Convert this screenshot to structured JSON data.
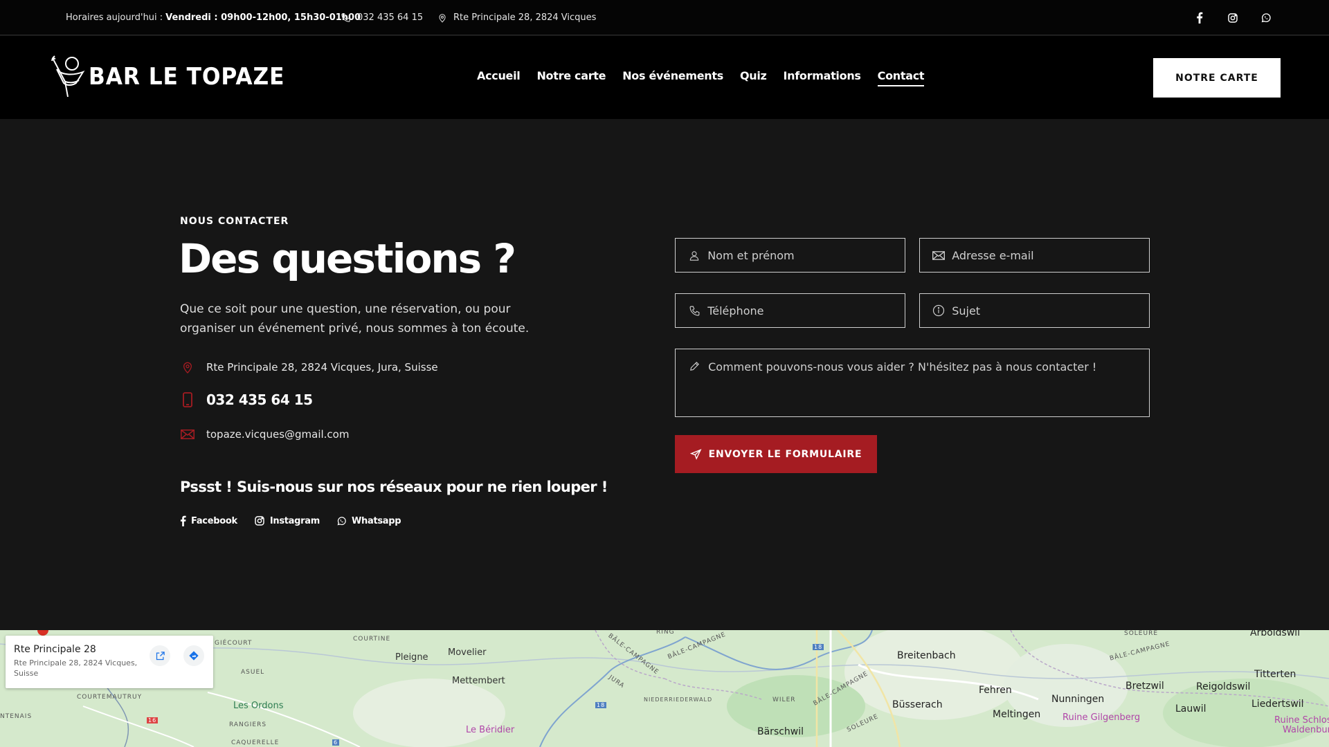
{
  "topbar": {
    "hours_label": "Horaires aujourd'hui :",
    "hours_value": "Vendredi : 09h00-12h00, 15h30-01h00",
    "phone": "032 435 64 15",
    "address": "Rte Principale 28, 2824 Vicques",
    "socials": [
      "facebook-icon",
      "instagram-icon",
      "whatsapp-icon"
    ]
  },
  "header": {
    "logo_text": "BAR LE TOPAZE",
    "nav": [
      "Accueil",
      "Notre carte",
      "Nos événements",
      "Quiz",
      "Informations",
      "Contact"
    ],
    "active_nav": "Contact",
    "cta_label": "NOTRE CARTE"
  },
  "contact": {
    "eyebrow": "NOUS CONTACTER",
    "title": "Des questions ?",
    "lead": "Que ce soit pour une question, une réservation, ou pour organiser un événement privé, nous sommes à ton écoute.",
    "address": "Rte Principale 28, 2824 Vicques, Jura, Suisse",
    "phone": "032 435 64 15",
    "email": "topaze.vicques@gmail.com",
    "social_title": "Pssst ! Suis-nous sur nos réseaux pour ne rien louper !",
    "social_links": [
      "Facebook",
      "Instagram",
      "Whatsapp"
    ],
    "accent": "#a51c22"
  },
  "form": {
    "name_placeholder": "Nom et prénom",
    "email_placeholder": "Adresse e-mail",
    "phone_placeholder": "Téléphone",
    "subject_placeholder": "Sujet",
    "message_placeholder": "Comment pouvons-nous vous aider ? N'hésitez pas à nous contacter !",
    "submit_label": "ENVOYER LE FORMULAIRE"
  },
  "map": {
    "card_title": "Rte Principale 28",
    "card_address": "Rte Principale 28, 2824 Vicques, Suisse",
    "labels": {
      "giecourt": "GIÉCOURT",
      "courtine": "COURTINE",
      "pleigne": "Pleigne",
      "movelier": "Movelier",
      "mettembert": "Mettembert",
      "asuel": "ASUEL",
      "courtemautruy": "COURTEMAUTRUY",
      "les_ordons": "Les Ordons",
      "rangiers": "RANGIERS",
      "caquerelle": "CAQUERELLE",
      "tenais": "NTENAIS",
      "le_beridier": "Le Béridier",
      "bale1": "BÂLE-CAMPAGNE",
      "bale2": "BÂLE-CAMPAGNE",
      "bale3": "BÂLE-CAMPAGNE",
      "bale4": "BÂLE-CAMPAGNE",
      "jura": "JURA",
      "niederriederwald": "NIEDERRIEDERWALD",
      "wiler": "WILER",
      "solothurn1": "SOLEURE",
      "solothurn2": "SOLEURE",
      "barschwil": "Bärschwil",
      "breitenbach": "Breitenbach",
      "busserach": "Büsserach",
      "fehren": "Fehren",
      "meltingen": "Meltingen",
      "nunningen": "Nunningen",
      "ruine": "Ruine Gilgenberg",
      "bretzwil": "Bretzwil",
      "reigoldswil": "Reigoldswil",
      "lauwil": "Lauwil",
      "titterten": "Titterten",
      "arboldswil": "Arboldswil",
      "liedertswil": "Liedertswil",
      "ruine_schloss": "Ruine Schlos",
      "waldenburg": "Waldenbur",
      "road18a": "18",
      "road18b": "18",
      "road16": "16",
      "road6": "6",
      "ring": "RING",
      "sol_top": "SOLEURE"
    }
  }
}
